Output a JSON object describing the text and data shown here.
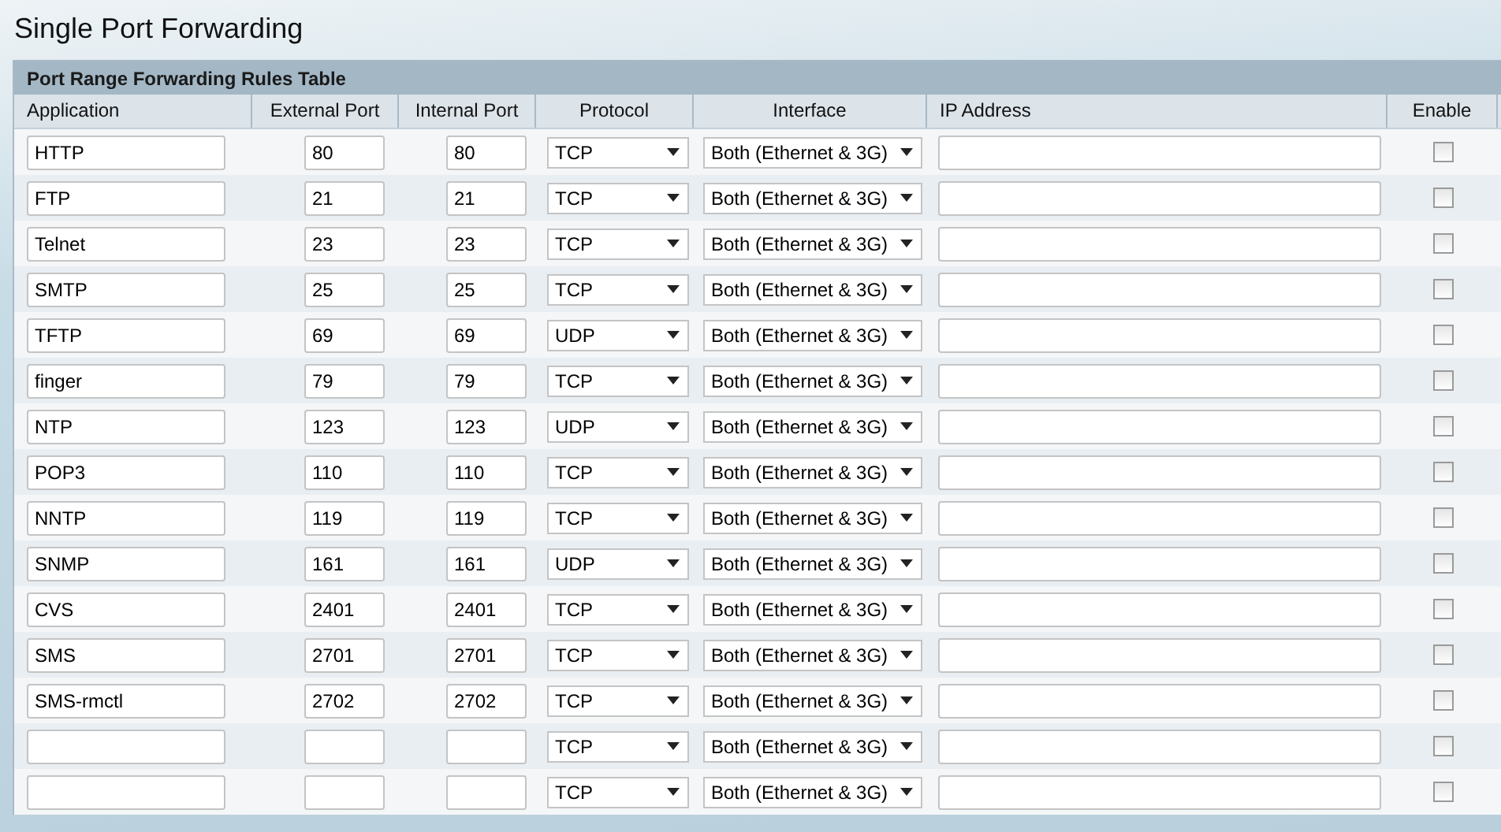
{
  "page_title": "Single Port Forwarding",
  "table": {
    "title": "Port Range Forwarding Rules Table",
    "columns": [
      "Application",
      "External Port",
      "Internal Port",
      "Protocol",
      "Interface",
      "IP Address",
      "Enable"
    ],
    "rows": [
      {
        "application": "HTTP",
        "external_port": "80",
        "internal_port": "80",
        "protocol": "TCP",
        "interface": "Both (Ethernet & 3G)",
        "enabled": false
      },
      {
        "application": "FTP",
        "external_port": "21",
        "internal_port": "21",
        "protocol": "TCP",
        "interface": "Both (Ethernet & 3G)",
        "enabled": false
      },
      {
        "application": "Telnet",
        "external_port": "23",
        "internal_port": "23",
        "protocol": "TCP",
        "interface": "Both (Ethernet & 3G)",
        "enabled": false
      },
      {
        "application": "SMTP",
        "external_port": "25",
        "internal_port": "25",
        "protocol": "TCP",
        "interface": "Both (Ethernet & 3G)",
        "enabled": false
      },
      {
        "application": "TFTP",
        "external_port": "69",
        "internal_port": "69",
        "protocol": "UDP",
        "interface": "Both (Ethernet & 3G)",
        "enabled": false
      },
      {
        "application": "finger",
        "external_port": "79",
        "internal_port": "79",
        "protocol": "TCP",
        "interface": "Both (Ethernet & 3G)",
        "enabled": false
      },
      {
        "application": "NTP",
        "external_port": "123",
        "internal_port": "123",
        "protocol": "UDP",
        "interface": "Both (Ethernet & 3G)",
        "enabled": false
      },
      {
        "application": "POP3",
        "external_port": "110",
        "internal_port": "110",
        "protocol": "TCP",
        "interface": "Both (Ethernet & 3G)",
        "enabled": false
      },
      {
        "application": "NNTP",
        "external_port": "119",
        "internal_port": "119",
        "protocol": "TCP",
        "interface": "Both (Ethernet & 3G)",
        "enabled": false
      },
      {
        "application": "SNMP",
        "external_port": "161",
        "internal_port": "161",
        "protocol": "UDP",
        "interface": "Both (Ethernet & 3G)",
        "enabled": false
      },
      {
        "application": "CVS",
        "external_port": "2401",
        "internal_port": "2401",
        "protocol": "TCP",
        "interface": "Both (Ethernet & 3G)",
        "enabled": false
      },
      {
        "application": "SMS",
        "external_port": "2701",
        "internal_port": "2701",
        "protocol": "TCP",
        "interface": "Both (Ethernet & 3G)",
        "enabled": false
      },
      {
        "application": "SMS-rmctl",
        "external_port": "2702",
        "internal_port": "2702",
        "protocol": "TCP",
        "interface": "Both (Ethernet & 3G)",
        "enabled": false
      },
      {
        "protocol": "TCP",
        "interface": "Both (Ethernet & 3G)",
        "enabled": false
      },
      {
        "protocol": "TCP",
        "interface": "Both (Ethernet & 3G)",
        "enabled": false
      }
    ]
  }
}
